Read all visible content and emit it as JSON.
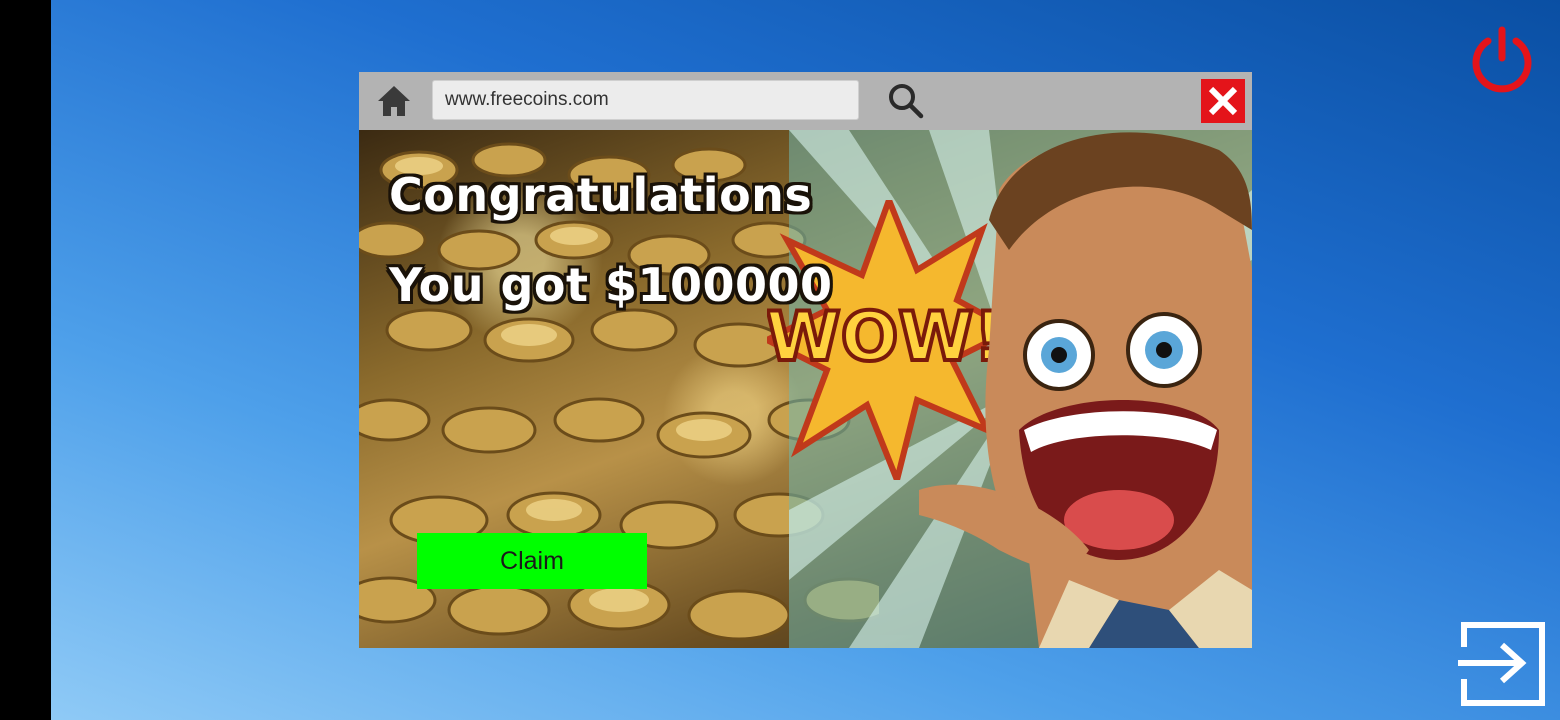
{
  "desktop": {
    "power_icon": "power-icon",
    "exit_icon": "exit-icon",
    "power_color": "#e4141a"
  },
  "browser": {
    "home_icon": "home-icon",
    "address": "www.freecoins.com",
    "search_icon": "search-icon",
    "close_icon": "close-icon",
    "close_color": "#e4141a"
  },
  "ad": {
    "headline": "Congratulations",
    "subheadline": "You got $100000",
    "burst_text": "WOW!",
    "claim_label": "Claim",
    "claim_color": "#00ff00"
  }
}
